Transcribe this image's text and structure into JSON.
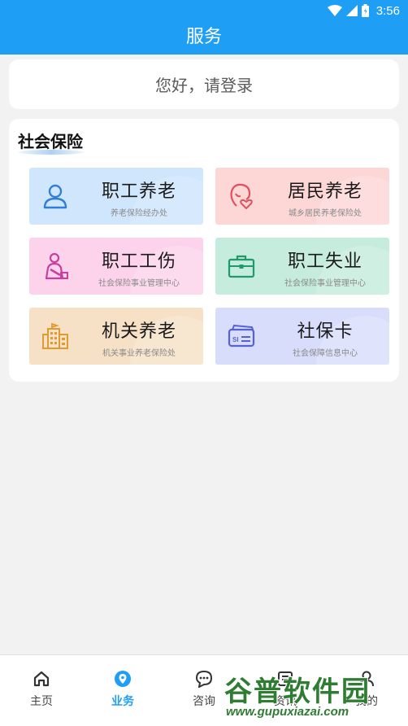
{
  "status_bar": {
    "time": "3:56",
    "icons": [
      "wifi-icon",
      "signal-icon",
      "battery-icon"
    ]
  },
  "header": {
    "title": "服务"
  },
  "login": {
    "text": "您好，请登录"
  },
  "section": {
    "title": "社会保险",
    "tiles": [
      {
        "title": "职工养老",
        "subtitle": "养老保险经办处",
        "icon": "person-icon",
        "bg": "#cfe6fd"
      },
      {
        "title": "居民养老",
        "subtitle": "城乡居民养老保险处",
        "icon": "heart-person-icon",
        "bg": "#fdd6d6"
      },
      {
        "title": "职工工伤",
        "subtitle": "社会保险事业管理中心",
        "icon": "injured-worker-icon",
        "bg": "#fdd3ec"
      },
      {
        "title": "职工失业",
        "subtitle": "社会保险事业管理中心",
        "icon": "briefcase-icon",
        "bg": "#c5ecdd"
      },
      {
        "title": "机关养老",
        "subtitle": "机关事业养老保险处",
        "icon": "building-icon",
        "bg": "#f6e1c6"
      },
      {
        "title": "社保卡",
        "subtitle": "社会保障信息中心",
        "icon": "card-icon",
        "bg": "#d8ddfb"
      }
    ]
  },
  "bottom_nav": {
    "items": [
      {
        "label": "主页",
        "icon": "home-icon"
      },
      {
        "label": "业务",
        "icon": "location-icon",
        "active": true
      },
      {
        "label": "咨询",
        "icon": "chat-icon"
      },
      {
        "label": "资讯",
        "icon": "news-icon"
      },
      {
        "label": "我的",
        "icon": "user-icon"
      }
    ]
  },
  "watermark": {
    "text": "谷普软件园",
    "url": "www.gupuxiazai.com"
  },
  "colors": {
    "primary": "#1e9ef5",
    "background": "#f2f2f2"
  }
}
